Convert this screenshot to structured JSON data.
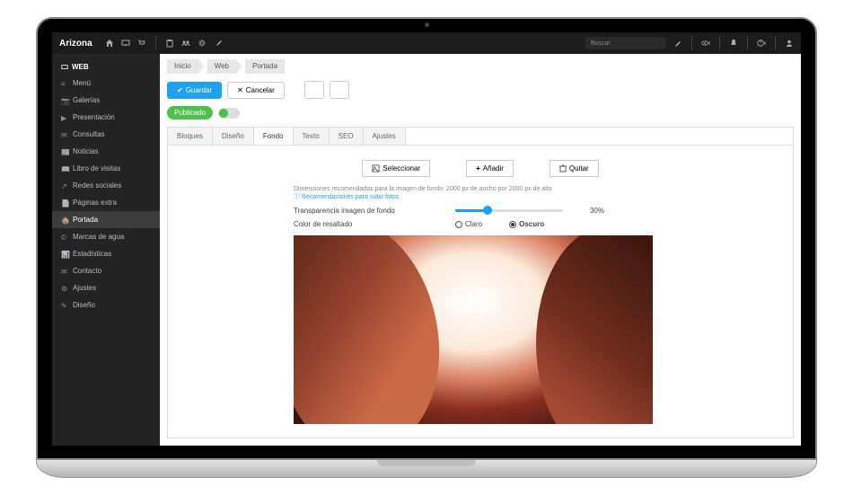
{
  "brand": "Arizona",
  "topbar": {
    "search_placeholder": "Buscar"
  },
  "sidebar": {
    "section": "WEB",
    "items": [
      {
        "label": "Menú"
      },
      {
        "label": "Galerías"
      },
      {
        "label": "Presentación"
      },
      {
        "label": "Consultas"
      },
      {
        "label": "Noticias"
      },
      {
        "label": "Libro de visitas"
      },
      {
        "label": "Redes sociales"
      },
      {
        "label": "Páginas extra"
      },
      {
        "label": "Portada"
      },
      {
        "label": "Marcas de agua"
      },
      {
        "label": "Estadísticas"
      },
      {
        "label": "Contacto"
      },
      {
        "label": "Ajustes"
      },
      {
        "label": "Diseño"
      }
    ],
    "active_index": 8
  },
  "breadcrumb": [
    "Inicio",
    "Web",
    "Portada"
  ],
  "actions": {
    "save": "Guardar",
    "cancel": "Cancelar",
    "status": "Publicado"
  },
  "tabs": {
    "items": [
      "Bloques",
      "Diseño",
      "Fondo",
      "Texto",
      "SEO",
      "Ajustes"
    ],
    "active_index": 2
  },
  "panel": {
    "select": "Seleccionar",
    "add": "Añadir",
    "remove": "Quitar",
    "dims_text": "Dimensiones recomendadas para la imagen de fondo: 2000 px de ancho por 2000 px de alto",
    "recs_link": "Recomendaciones para subir fotos",
    "transparency_label": "Transparencia imagen de fondo",
    "transparency_value": "30%",
    "highlight_label": "Color de resaltado",
    "opt_light": "Claro",
    "opt_dark": "Oscuro"
  }
}
